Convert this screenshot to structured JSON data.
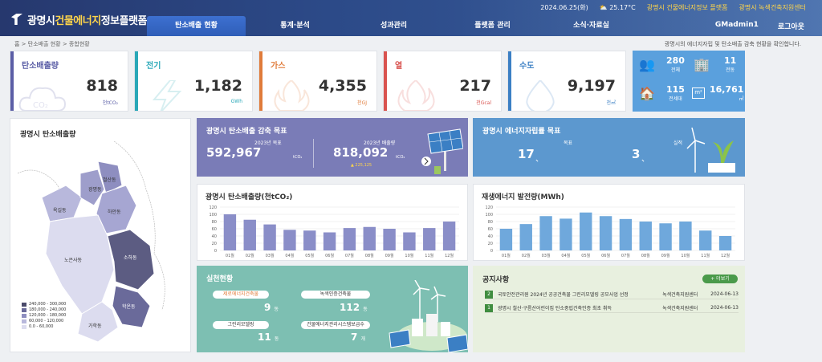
{
  "header": {
    "logo_text_1": "광명시",
    "logo_text_hl": "건물에너지",
    "logo_text_2": "정보플랫폼",
    "date": "2024.06.25(화)",
    "weather": "25.17°C",
    "link1": "광명시 건물에너지정보 플랫폼",
    "link2": "광명시 녹색건축지원센터",
    "nav": [
      "탄소배출 현황",
      "통계·분석",
      "성과관리",
      "플랫폼 관리",
      "소식·자료실"
    ],
    "user": "GMadmin1",
    "logout": "로그아웃"
  },
  "breadcrumb": "홈 > 탄소배출 현황 > 종합현황",
  "page_desc": "광명시의 에너지자립 및 탄소배출 감축 현황을 확인합니다.",
  "cards": [
    {
      "title": "탄소배출량",
      "value": "818",
      "unit": "천tCO₂",
      "color": "#5b5ea6"
    },
    {
      "title": "전기",
      "value": "1,182",
      "unit": "GWh",
      "color": "#2aa8b8"
    },
    {
      "title": "가스",
      "value": "4,355",
      "unit": "천GJ",
      "color": "#e07b3a"
    },
    {
      "title": "열",
      "value": "217",
      "unit": "천Gcal",
      "color": "#d9534f"
    },
    {
      "title": "수도",
      "value": "9,197",
      "unit": "천㎥",
      "color": "#3b7fc4"
    }
  ],
  "buildings": {
    "a_value": "280",
    "a_label": "전체",
    "b_value": "11",
    "b_label": "전동",
    "c_value": "115",
    "c_label": "전세대",
    "d_value": "16,761",
    "d_label": "㎡"
  },
  "map": {
    "title": "광명시 탄소배출량",
    "districts": [
      "철산동",
      "광명동",
      "하안동",
      "소하동",
      "학온동",
      "노은사동",
      "가학동",
      "옥길동"
    ],
    "legend": [
      "240,000 - 300,000",
      "180,000 - 240,000",
      "120,000 - 180,000",
      "60,000 - 120,000",
      "0.0 - 60,000"
    ],
    "legend_colors": [
      "#4a4a6a",
      "#6a6a9a",
      "#8e8ec0",
      "#b8b8dc",
      "#dcdcef"
    ]
  },
  "reduction": {
    "title": "광명시 탄소배출 감축 목표",
    "target_label": "2023년 목표",
    "target_value": "592,967",
    "target_unit": "tCO₂",
    "actual_label": "2023년 배출량",
    "actual_value": "818,092",
    "actual_unit": "tCO₂",
    "diff": "▲ 225,125"
  },
  "selfsuff": {
    "title": "광명시 에너지자립률 목표",
    "goal_label": "목표",
    "goal_value": "17",
    "real_label": "실적",
    "real_value": "3"
  },
  "chart1": {
    "title": "광명시 탄소배출량(천tCO₂)"
  },
  "chart2": {
    "title": "재생에너지 발전량(MWh)"
  },
  "chart_data": [
    {
      "type": "bar",
      "title": "광명시 탄소배출량(천tCO₂)",
      "categories": [
        "01월",
        "02월",
        "03월",
        "04월",
        "05월",
        "06월",
        "07월",
        "08월",
        "09월",
        "10월",
        "11월",
        "12월"
      ],
      "values": [
        100,
        85,
        72,
        57,
        55,
        50,
        62,
        65,
        60,
        50,
        62,
        80
      ],
      "ylim": [
        0,
        120
      ],
      "yticks": [
        0,
        20,
        40,
        60,
        80,
        100,
        120
      ],
      "color": "#8a8ec8"
    },
    {
      "type": "bar",
      "title": "재생에너지 발전량(MWh)",
      "categories": [
        "01월",
        "02월",
        "03월",
        "04월",
        "05월",
        "06월",
        "07월",
        "08월",
        "09월",
        "10월",
        "11월",
        "12월"
      ],
      "values": [
        60,
        73,
        95,
        88,
        105,
        95,
        87,
        80,
        75,
        80,
        55,
        40
      ],
      "ylim": [
        0,
        120
      ],
      "yticks": [
        0,
        20,
        40,
        60,
        80,
        100,
        120
      ],
      "color": "#6fa8dc"
    }
  ],
  "practice": {
    "title": "실천현황",
    "items": [
      {
        "label": "제로에너지건축물",
        "value": "9",
        "unit": "동"
      },
      {
        "label": "녹색인증건축물",
        "value": "112",
        "unit": "동"
      },
      {
        "label": "그린리모델링",
        "value": "11",
        "unit": "동"
      },
      {
        "label": "건물에너지관리시스템보급수",
        "value": "7",
        "unit": "개"
      }
    ]
  },
  "notice": {
    "title": "공지사항",
    "more": "+ 더보기",
    "rows": [
      {
        "num": "2",
        "text": "국토안전관리원 2024년 공공건축물 그린리모델링 공모사업 선정",
        "org": "녹색건축지원센터",
        "date": "2024-06-13"
      },
      {
        "num": "1",
        "text": "광명시 철산·구름산어린이집 탄소중립건축인증 최초 취득",
        "org": "녹색건축지원센터",
        "date": "2024-06-13"
      }
    ]
  }
}
